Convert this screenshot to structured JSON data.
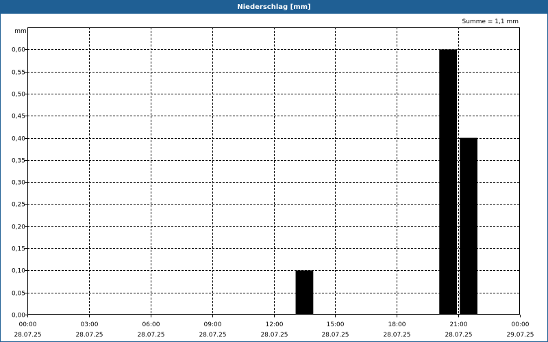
{
  "chart_data": {
    "type": "bar",
    "title": "Niederschlag [mm]",
    "ylabel": "mm",
    "annotation": "Summe = 1,1 mm",
    "ylim": [
      0,
      0.65
    ],
    "yticks": [
      0,
      0.05,
      0.1,
      0.15,
      0.2,
      0.25,
      0.3,
      0.35,
      0.4,
      0.45,
      0.5,
      0.55,
      0.6
    ],
    "ytick_labels": [
      "0,00",
      "0,05",
      "0,10",
      "0,15",
      "0,20",
      "0,25",
      "0,30",
      "0,35",
      "0,40",
      "0,45",
      "0,50",
      "0,55",
      "0,60"
    ],
    "xlim_hours": [
      0,
      24
    ],
    "xticks": [
      {
        "hour": 0,
        "time": "00:00",
        "date": "28.07.25"
      },
      {
        "hour": 3,
        "time": "03:00",
        "date": "28.07.25"
      },
      {
        "hour": 6,
        "time": "06:00",
        "date": "28.07.25"
      },
      {
        "hour": 9,
        "time": "09:00",
        "date": "28.07.25"
      },
      {
        "hour": 12,
        "time": "12:00",
        "date": "28.07.25"
      },
      {
        "hour": 15,
        "time": "15:00",
        "date": "28.07.25"
      },
      {
        "hour": 18,
        "time": "18:00",
        "date": "28.07.25"
      },
      {
        "hour": 21,
        "time": "21:00",
        "date": "28.07.25"
      },
      {
        "hour": 24,
        "time": "00:00",
        "date": "29.07.25"
      }
    ],
    "bars": [
      {
        "start": 13.0,
        "end": 14.0,
        "value": 0.1
      },
      {
        "start": 20.0,
        "end": 21.0,
        "value": 0.6
      },
      {
        "start": 21.0,
        "end": 22.0,
        "value": 0.4
      }
    ],
    "grid": true,
    "bar_color": "#000000"
  }
}
